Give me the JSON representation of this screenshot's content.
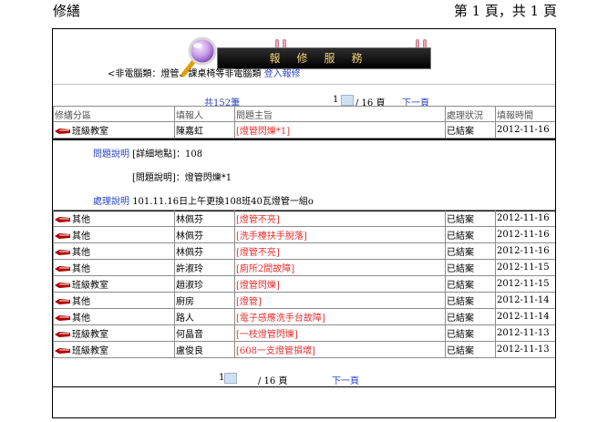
{
  "page": {
    "left_title": "修繕",
    "right_title": "第 1 頁，共 1 頁"
  },
  "banner": {
    "text": "報修服務",
    "accent_color": "#f1d37a"
  },
  "notice": {
    "text": "<非電腦類：燈管、課桌椅等非電腦類",
    "link": "登入報修"
  },
  "pager_top": {
    "total": "共152筆",
    "current": "1",
    "of": "/ 16 頁",
    "next": "下一頁"
  },
  "pager_bottom": {
    "current": "1",
    "of": "/ 16 頁",
    "next": "下一頁"
  },
  "table": {
    "headers": [
      "修繕分區",
      "填報人",
      "問題主旨",
      "處理狀況",
      "填報時間"
    ],
    "first_row": {
      "category": "班級教室",
      "reporter": "陳嘉虹",
      "subject": "[燈管閃爍*1]",
      "status": "已結案",
      "date": "2012-11-16"
    },
    "detail": {
      "label1": "問題說明",
      "location": "[詳細地點]：108",
      "description": "[問題說明]：燈管閃爍*1",
      "label2": "處理說明",
      "resolution": "101.11.16日上午更換108班40瓦燈管一組o"
    },
    "rows": [
      {
        "category": "其他",
        "reporter": "林佩芬",
        "subject": "[燈管不亮]",
        "status": "已結案",
        "date": "2012-11-16"
      },
      {
        "category": "其他",
        "reporter": "林佩芬",
        "subject": "[洗手檯扶手脫落]",
        "status": "已結案",
        "date": "2012-11-16"
      },
      {
        "category": "其他",
        "reporter": "林佩芬",
        "subject": "[燈管不亮]",
        "status": "已結案",
        "date": "2012-11-16"
      },
      {
        "category": "其他",
        "reporter": "許淑玲",
        "subject": "[廁所2間故障]",
        "status": "已結案",
        "date": "2012-11-15"
      },
      {
        "category": "班級教室",
        "reporter": "趙淑珍",
        "subject": "[燈管閃爍]",
        "status": "已結案",
        "date": "2012-11-15"
      },
      {
        "category": "其他",
        "reporter": "廚房",
        "subject": "[燈管]",
        "status": "已結案",
        "date": "2012-11-14"
      },
      {
        "category": "其他",
        "reporter": "路人",
        "subject": "[電子感應洗手台故障]",
        "status": "已結案",
        "date": "2012-11-14"
      },
      {
        "category": "班級教室",
        "reporter": "何晶音",
        "subject": "[一枝燈管閃爍]",
        "status": "已結案",
        "date": "2012-11-13"
      },
      {
        "category": "班級教室",
        "reporter": "盧俊良",
        "subject": "[608一支燈管損壞]",
        "status": "已結案",
        "date": "2012-11-13"
      }
    ]
  }
}
